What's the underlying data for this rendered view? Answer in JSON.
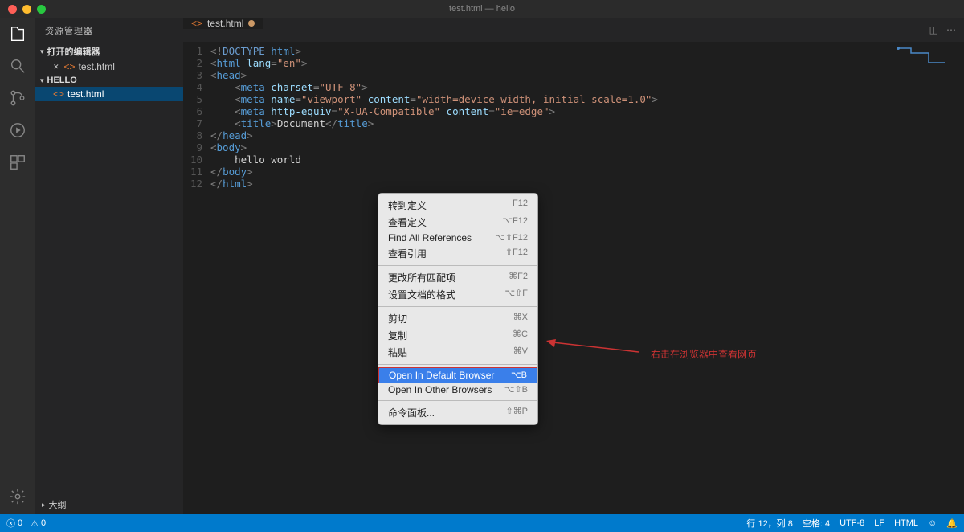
{
  "titlebar": {
    "title": "test.html — hello"
  },
  "sidebar": {
    "header": "资源管理器",
    "sections": [
      {
        "label": "打开的编辑器",
        "expanded": true,
        "items": [
          {
            "label": "test.html",
            "modified": true
          }
        ]
      },
      {
        "label": "HELLO",
        "expanded": true,
        "items": [
          {
            "label": "test.html"
          }
        ]
      }
    ],
    "outline": "大纲"
  },
  "tabs": [
    {
      "label": "test.html",
      "modified": true
    }
  ],
  "code": {
    "lines": [
      {
        "n": 1,
        "tokens": [
          [
            "<!",
            "c-punct"
          ],
          [
            "DOCTYPE",
            "c-kw"
          ],
          [
            " ",
            "c-punct"
          ],
          [
            "html",
            "c-tag"
          ],
          [
            ">",
            "c-punct"
          ]
        ]
      },
      {
        "n": 2,
        "tokens": [
          [
            "<",
            "c-punct"
          ],
          [
            "html",
            "c-tag"
          ],
          [
            " ",
            "c-punct"
          ],
          [
            "lang",
            "c-attr"
          ],
          [
            "=",
            "c-punct"
          ],
          [
            "\"en\"",
            "c-str"
          ],
          [
            ">",
            "c-punct"
          ]
        ]
      },
      {
        "n": 3,
        "tokens": [
          [
            "<",
            "c-punct"
          ],
          [
            "head",
            "c-tag"
          ],
          [
            ">",
            "c-punct"
          ]
        ]
      },
      {
        "n": 4,
        "tokens": [
          [
            "    <",
            "c-punct"
          ],
          [
            "meta",
            "c-tag"
          ],
          [
            " ",
            "c-punct"
          ],
          [
            "charset",
            "c-attr"
          ],
          [
            "=",
            "c-punct"
          ],
          [
            "\"UTF-8\"",
            "c-str"
          ],
          [
            ">",
            "c-punct"
          ]
        ]
      },
      {
        "n": 5,
        "tokens": [
          [
            "    <",
            "c-punct"
          ],
          [
            "meta",
            "c-tag"
          ],
          [
            " ",
            "c-punct"
          ],
          [
            "name",
            "c-attr"
          ],
          [
            "=",
            "c-punct"
          ],
          [
            "\"viewport\"",
            "c-str"
          ],
          [
            " ",
            "c-punct"
          ],
          [
            "content",
            "c-attr"
          ],
          [
            "=",
            "c-punct"
          ],
          [
            "\"width=device-width, initial-scale=1.0\"",
            "c-str"
          ],
          [
            ">",
            "c-punct"
          ]
        ]
      },
      {
        "n": 6,
        "tokens": [
          [
            "    <",
            "c-punct"
          ],
          [
            "meta",
            "c-tag"
          ],
          [
            " ",
            "c-punct"
          ],
          [
            "http-equiv",
            "c-attr"
          ],
          [
            "=",
            "c-punct"
          ],
          [
            "\"X-UA-Compatible\"",
            "c-str"
          ],
          [
            " ",
            "c-punct"
          ],
          [
            "content",
            "c-attr"
          ],
          [
            "=",
            "c-punct"
          ],
          [
            "\"ie=edge\"",
            "c-str"
          ],
          [
            ">",
            "c-punct"
          ]
        ]
      },
      {
        "n": 7,
        "tokens": [
          [
            "    <",
            "c-punct"
          ],
          [
            "title",
            "c-tag"
          ],
          [
            ">",
            "c-punct"
          ],
          [
            "Document",
            ""
          ],
          [
            "</",
            "c-punct"
          ],
          [
            "title",
            "c-tag"
          ],
          [
            ">",
            "c-punct"
          ]
        ]
      },
      {
        "n": 8,
        "tokens": [
          [
            "</",
            "c-punct"
          ],
          [
            "head",
            "c-tag"
          ],
          [
            ">",
            "c-punct"
          ]
        ]
      },
      {
        "n": 9,
        "tokens": [
          [
            "<",
            "c-punct"
          ],
          [
            "body",
            "c-tag"
          ],
          [
            ">",
            "c-punct"
          ]
        ]
      },
      {
        "n": 10,
        "tokens": [
          [
            "    hello world",
            ""
          ]
        ]
      },
      {
        "n": 11,
        "tokens": [
          [
            "</",
            "c-punct"
          ],
          [
            "body",
            "c-tag"
          ],
          [
            ">",
            "c-punct"
          ]
        ]
      },
      {
        "n": 12,
        "tokens": [
          [
            "</",
            "c-punct"
          ],
          [
            "html",
            "c-tag"
          ],
          [
            ">",
            "c-punct"
          ]
        ]
      }
    ]
  },
  "context_menu": {
    "groups": [
      [
        {
          "label": "转到定义",
          "shortcut": "F12"
        },
        {
          "label": "查看定义",
          "shortcut": "⌥F12"
        },
        {
          "label": "Find All References",
          "shortcut": "⌥⇧F12"
        },
        {
          "label": "查看引用",
          "shortcut": "⇧F12"
        }
      ],
      [
        {
          "label": "更改所有匹配项",
          "shortcut": "⌘F2"
        },
        {
          "label": "设置文档的格式",
          "shortcut": "⌥⇧F"
        }
      ],
      [
        {
          "label": "剪切",
          "shortcut": "⌘X"
        },
        {
          "label": "复制",
          "shortcut": "⌘C"
        },
        {
          "label": "粘贴",
          "shortcut": "⌘V"
        }
      ],
      [
        {
          "label": "Open In Default Browser",
          "shortcut": "⌥B",
          "highlight": true
        },
        {
          "label": "Open In Other Browsers",
          "shortcut": "⌥⇧B"
        }
      ],
      [
        {
          "label": "命令面板...",
          "shortcut": "⇧⌘P"
        }
      ]
    ]
  },
  "annotation": "右击在浏览器中查看网页",
  "statusbar": {
    "left": [
      {
        "icon": "errors-icon",
        "text": "0"
      },
      {
        "icon": "warnings-icon",
        "text": "0"
      }
    ],
    "right": [
      {
        "text": "行 12，列 8"
      },
      {
        "text": "空格: 4"
      },
      {
        "text": "UTF-8"
      },
      {
        "text": "LF"
      },
      {
        "text": "HTML"
      },
      {
        "icon": "feedback-icon",
        "text": ""
      },
      {
        "icon": "bell-icon",
        "text": ""
      }
    ]
  }
}
